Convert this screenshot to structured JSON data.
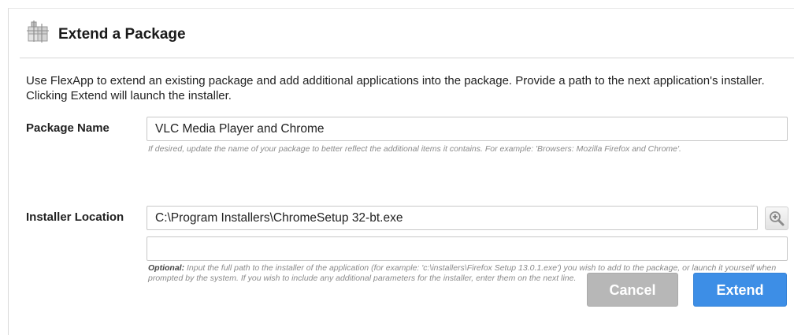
{
  "dialog": {
    "title": "Extend a Package",
    "header_icon": "package-extend-icon",
    "intro": "Use FlexApp to extend an existing package and add additional applications into the package. Provide a path to the next application's installer. Clicking Extend will launch the installer."
  },
  "package_name": {
    "label": "Package Name",
    "value": "VLC Media Player and Chrome",
    "hint": "If desired, update the name of your package to better reflect the additional items it contains. For example: 'Browsers: Mozilla Firefox and Chrome'."
  },
  "installer_location": {
    "label": "Installer Location",
    "value": "C:\\Program Installers\\ChromeSetup 32-bt.exe",
    "parameters_value": "",
    "search_icon": "magnifier-plus-icon",
    "hint_prefix": "Optional:",
    "hint": " Input the full path to the installer of the application (for example: 'c:\\installers\\Firefox Setup 13.0.1.exe') you wish to add to the package, or launch it yourself when prompted by the system. If you wish to include any additional parameters for the installer, enter them on the next line."
  },
  "buttons": {
    "cancel": "Cancel",
    "extend": "Extend"
  },
  "colors": {
    "primary_button": "#3d8ee6",
    "disabled_button": "#b7b7b7"
  }
}
